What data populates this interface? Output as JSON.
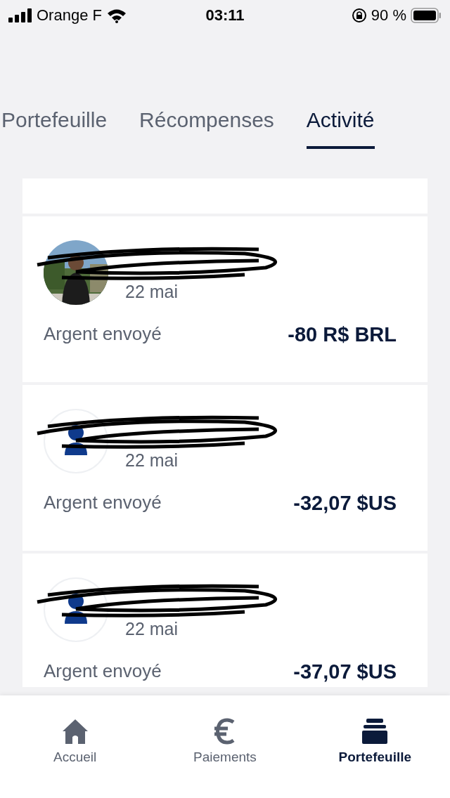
{
  "status_bar": {
    "carrier": "Orange F",
    "time": "03:11",
    "battery": "90 %"
  },
  "tabs": [
    {
      "label": "Portefeuille",
      "selected": false
    },
    {
      "label": "Récompenses",
      "selected": false
    },
    {
      "label": "Activité",
      "selected": true
    }
  ],
  "activity": [
    {
      "date": "22 mai",
      "description": "Argent envoyé",
      "amount": "-80 R$ BRL"
    },
    {
      "kind": "person",
      "date": "22 mai",
      "description": "Argent envoyé",
      "amount": "-32,07 $US"
    },
    {
      "kind": "person",
      "date": "22 mai",
      "description": "Argent envoyé",
      "amount": "-37,07 $US"
    }
  ],
  "bottom_nav": [
    {
      "label": "Accueil",
      "selected": false
    },
    {
      "label": "Paiements",
      "selected": false
    },
    {
      "label": "Portefeuille",
      "selected": true
    }
  ]
}
